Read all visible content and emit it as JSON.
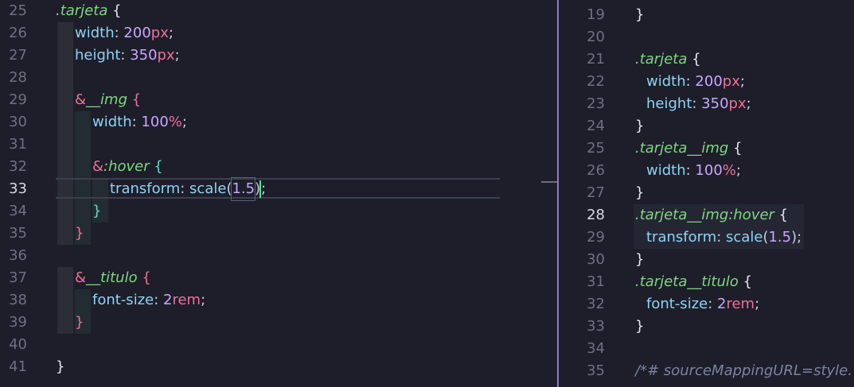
{
  "left_editor": {
    "lines": [
      {
        "n": "25",
        "tokens": [
          [
            "sel",
            ".tarjeta"
          ],
          [
            "br",
            " {"
          ]
        ]
      },
      {
        "n": "26",
        "tokens": [
          [
            "prop",
            "width"
          ],
          [
            "punc",
            ": "
          ],
          [
            "num",
            "200"
          ],
          [
            "unit",
            "px"
          ],
          [
            "punc",
            ";"
          ]
        ]
      },
      {
        "n": "27",
        "tokens": [
          [
            "prop",
            "height"
          ],
          [
            "punc",
            ": "
          ],
          [
            "num",
            "350"
          ],
          [
            "unit",
            "px"
          ],
          [
            "punc",
            ";"
          ]
        ]
      },
      {
        "n": "28",
        "tokens": []
      },
      {
        "n": "29",
        "tokens": [
          [
            "amp",
            "&"
          ],
          [
            "sel",
            "__img"
          ],
          [
            "br-pink",
            " {"
          ]
        ]
      },
      {
        "n": "30",
        "tokens": [
          [
            "prop",
            "width"
          ],
          [
            "punc",
            ": "
          ],
          [
            "num",
            "100"
          ],
          [
            "unit",
            "%"
          ],
          [
            "punc",
            ";"
          ]
        ]
      },
      {
        "n": "31",
        "tokens": []
      },
      {
        "n": "32",
        "tokens": [
          [
            "amp",
            "&"
          ],
          [
            "sel",
            ":hover"
          ],
          [
            "br-cyan",
            " {"
          ]
        ]
      },
      {
        "n": "33",
        "tokens": [
          [
            "prop",
            "transform"
          ],
          [
            "punc",
            ": "
          ],
          [
            "fn",
            "scale"
          ],
          [
            "punc",
            "("
          ],
          [
            "num",
            "1.5"
          ],
          [
            "punc",
            ")"
          ],
          [
            "punc",
            ";"
          ]
        ]
      },
      {
        "n": "34",
        "tokens": [
          [
            "br-cyan",
            "}"
          ]
        ]
      },
      {
        "n": "35",
        "tokens": [
          [
            "br-pink",
            "}"
          ]
        ]
      },
      {
        "n": "36",
        "tokens": []
      },
      {
        "n": "37",
        "tokens": [
          [
            "amp",
            "&"
          ],
          [
            "sel",
            "__titulo"
          ],
          [
            "br-pink",
            " {"
          ]
        ]
      },
      {
        "n": "38",
        "tokens": [
          [
            "prop",
            "font-size"
          ],
          [
            "punc",
            ": "
          ],
          [
            "num",
            "2"
          ],
          [
            "unit",
            "rem"
          ],
          [
            "punc",
            ";"
          ]
        ]
      },
      {
        "n": "39",
        "tokens": [
          [
            "br-pink",
            "}"
          ]
        ]
      },
      {
        "n": "40",
        "tokens": []
      },
      {
        "n": "41",
        "tokens": [
          [
            "br",
            "}"
          ]
        ]
      }
    ],
    "active_line": "33"
  },
  "right_editor": {
    "lines": [
      {
        "n": "19",
        "tokens": [
          [
            "br",
            "}"
          ]
        ]
      },
      {
        "n": "20",
        "tokens": []
      },
      {
        "n": "21",
        "tokens": [
          [
            "sel",
            ".tarjeta"
          ],
          [
            "br",
            " {"
          ]
        ]
      },
      {
        "n": "22",
        "tokens": [
          [
            "prop",
            "width"
          ],
          [
            "punc",
            ": "
          ],
          [
            "num",
            "200"
          ],
          [
            "unit",
            "px"
          ],
          [
            "punc",
            ";"
          ]
        ]
      },
      {
        "n": "23",
        "tokens": [
          [
            "prop",
            "height"
          ],
          [
            "punc",
            ": "
          ],
          [
            "num",
            "350"
          ],
          [
            "unit",
            "px"
          ],
          [
            "punc",
            ";"
          ]
        ]
      },
      {
        "n": "24",
        "tokens": [
          [
            "br",
            "}"
          ]
        ]
      },
      {
        "n": "25",
        "tokens": [
          [
            "sel",
            ".tarjeta__img"
          ],
          [
            "br",
            " {"
          ]
        ]
      },
      {
        "n": "26",
        "tokens": [
          [
            "prop",
            "width"
          ],
          [
            "punc",
            ": "
          ],
          [
            "num",
            "100"
          ],
          [
            "unit",
            "%"
          ],
          [
            "punc",
            ";"
          ]
        ]
      },
      {
        "n": "27",
        "tokens": [
          [
            "br",
            "}"
          ]
        ]
      },
      {
        "n": "28",
        "tokens": [
          [
            "sel",
            ".tarjeta__img:hover"
          ],
          [
            "br",
            " {"
          ]
        ]
      },
      {
        "n": "29",
        "tokens": [
          [
            "prop",
            "transform"
          ],
          [
            "punc",
            ": "
          ],
          [
            "fn",
            "scale"
          ],
          [
            "punc",
            "("
          ],
          [
            "num",
            "1.5"
          ],
          [
            "punc",
            ")"
          ],
          [
            "punc",
            ";"
          ]
        ]
      },
      {
        "n": "30",
        "tokens": [
          [
            "br",
            "}"
          ]
        ]
      },
      {
        "n": "31",
        "tokens": [
          [
            "sel",
            ".tarjeta__titulo"
          ],
          [
            "br",
            " {"
          ]
        ]
      },
      {
        "n": "32",
        "tokens": [
          [
            "prop",
            "font-size"
          ],
          [
            "punc",
            ": "
          ],
          [
            "num",
            "2"
          ],
          [
            "unit",
            "rem"
          ],
          [
            "punc",
            ";"
          ]
        ]
      },
      {
        "n": "33",
        "tokens": [
          [
            "br",
            "}"
          ]
        ]
      },
      {
        "n": "34",
        "tokens": []
      },
      {
        "n": "35",
        "tokens": [
          [
            "comment",
            "/*# sourceMappingURL=style."
          ]
        ]
      }
    ],
    "active_line": "28"
  }
}
